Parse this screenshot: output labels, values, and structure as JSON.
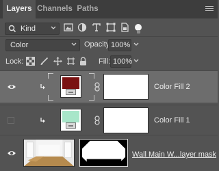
{
  "tabs": [
    {
      "label": "Layers",
      "active": true
    },
    {
      "label": "Channels",
      "active": false
    },
    {
      "label": "Paths",
      "active": false
    }
  ],
  "filter": {
    "kind_label": "Kind",
    "icons": [
      "pixel-filter-icon",
      "adjustment-filter-icon",
      "type-filter-icon",
      "shape-filter-icon",
      "smart-object-filter-icon",
      "filter-toggle-icon"
    ]
  },
  "blend": {
    "mode": "Color",
    "opacity_label": "Opacity:",
    "opacity_value": "100%"
  },
  "lock": {
    "label": "Lock:",
    "icons": [
      "lock-transparent-icon",
      "lock-image-icon",
      "lock-position-icon",
      "lock-artboard-icon",
      "lock-all-icon"
    ],
    "fill_label": "Fill:",
    "fill_value": "100%"
  },
  "layers": [
    {
      "name": "Color Fill 2",
      "visible": true,
      "selected": true,
      "clipped": true,
      "swatch": "#7a1212"
    },
    {
      "name": "Color Fill 1",
      "visible": false,
      "selected": false,
      "clipped": true,
      "swatch": "#a8e6c9"
    },
    {
      "name": "Wall Main W...layer mask",
      "visible": true,
      "selected": false,
      "clipped": false
    }
  ],
  "colors": {
    "panel_bg": "#535353",
    "tabbar_bg": "#3d3d3d",
    "selected_row": "#6d6d6d"
  }
}
